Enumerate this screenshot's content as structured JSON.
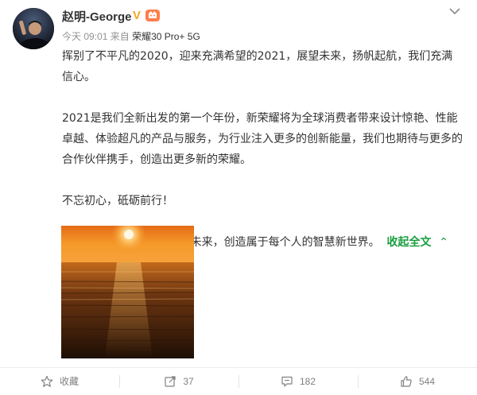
{
  "header": {
    "username": "赵明-George",
    "verified_mark": "V",
    "meta_time": "今天 09:01",
    "meta_from": "来自",
    "meta_source": "荣耀30 Pro+ 5G"
  },
  "content": {
    "paragraphs": [
      "挥别了不平凡的2020，迎来充满希望的2021，展望未来，扬帆起航，我们充满信心。",
      "2021是我们全新出发的第一个年份，新荣耀将为全球消费者带来设计惊艳、性能卓越、体验超凡的产品与服务，为行业注入更多的创新能量，我们也期待与更多的合作伙伴携手，创造出更多新的荣耀。",
      "不忘初心，砥砺前行！",
      "2021年，让我们一起面向未来，创造属于每个人的智慧新世界。"
    ],
    "collapse_label": "收起全文",
    "collapse_chevron": "⌃"
  },
  "footer": {
    "favorite_label": "收藏",
    "repost_count": "37",
    "comment_count": "182",
    "like_count": "544"
  },
  "icons": {
    "more": "chevron-down-icon",
    "favorite": "star-icon",
    "repost": "share-icon",
    "comment": "comment-icon",
    "like": "thumbs-up-icon"
  },
  "colors": {
    "link_green": "#1a9e3f",
    "verified_orange": "#f5a623",
    "meta_gray": "#939393"
  }
}
